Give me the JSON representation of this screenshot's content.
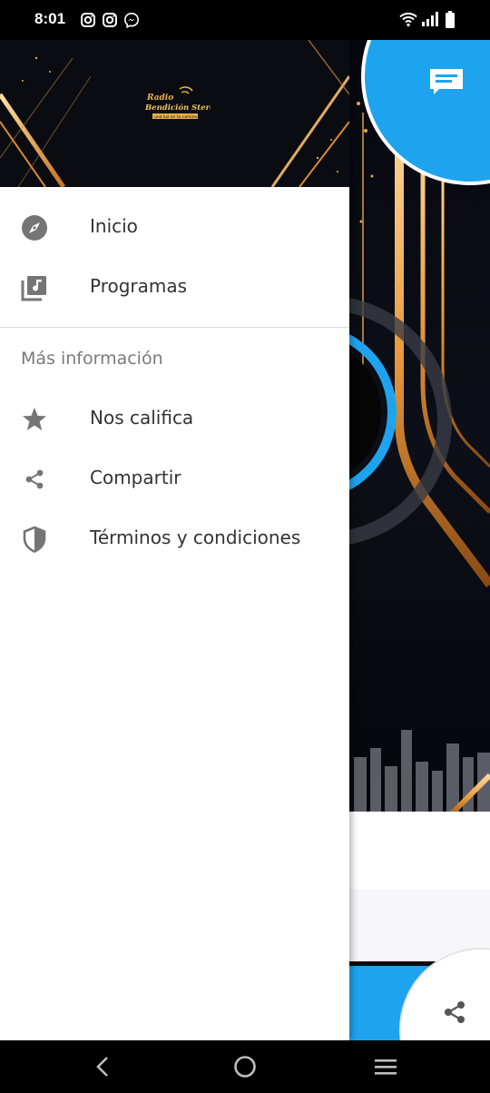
{
  "status_bar": {
    "time": "8:01",
    "notification_icons": [
      "instagram-icon",
      "instagram-icon",
      "messenger-icon"
    ],
    "system_icons": [
      "wifi-icon",
      "signal-icon",
      "battery-icon"
    ]
  },
  "drawer": {
    "logo_text": "Radio Bendición Stereo",
    "logo_tagline": "una luz en tu camino",
    "items": [
      {
        "label": "Inicio",
        "icon": "compass-icon"
      },
      {
        "label": "Programas",
        "icon": "music-library-icon"
      }
    ],
    "section_title": "Más información",
    "section_items": [
      {
        "label": "Nos califica",
        "icon": "star-icon"
      },
      {
        "label": "Compartir",
        "icon": "share-icon"
      },
      {
        "label": "Términos y condiciones",
        "icon": "shield-icon"
      }
    ]
  },
  "background": {
    "chat_button_icon": "chat-icon",
    "share_button_icon": "share-icon",
    "accent_color": "#1ea4ef"
  },
  "nav_bar": {
    "buttons": [
      "back-icon",
      "home-icon",
      "recents-icon"
    ]
  }
}
